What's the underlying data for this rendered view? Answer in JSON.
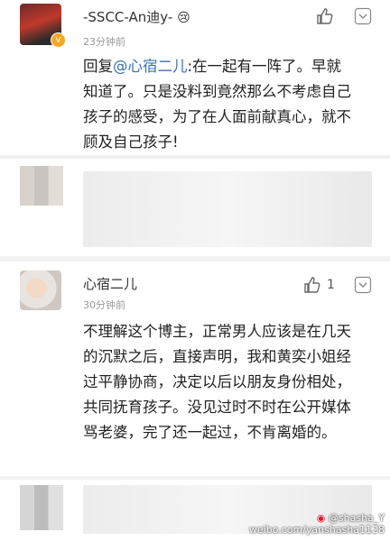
{
  "comments": [
    {
      "username": "-SSCC-An迪y-",
      "emoji": "😢",
      "time": "23分钟前",
      "reply_prefix": "回复",
      "reply_mention": "@心宿二儿",
      "reply_rest": ":在一起有一阵了。早就知道了。只是没料到竟然那么不考虑自己孩子的感受，为了在人面前献真心，就不顾及自己孩子!",
      "like_icon": "thumbs-up-icon",
      "more_icon": "chevron-down-icon"
    },
    {
      "username": "心宿二儿",
      "time": "30分钟前",
      "text": "不理解这个博主，正常男人应该是在几天的沉默之后，直接声明，我和黄奕小姐经过平静协商，决定以后以朋友身份相处，共同抚育孩子。没见过时不时在公开媒体骂老婆，完了还一起过，不肯离婚的。",
      "like_count": "1",
      "like_icon": "thumbs-up-icon",
      "more_icon": "chevron-down-icon"
    }
  ],
  "watermark": {
    "handle": "@shasha_Y",
    "url": "weibo.com/yanshasha1128"
  }
}
